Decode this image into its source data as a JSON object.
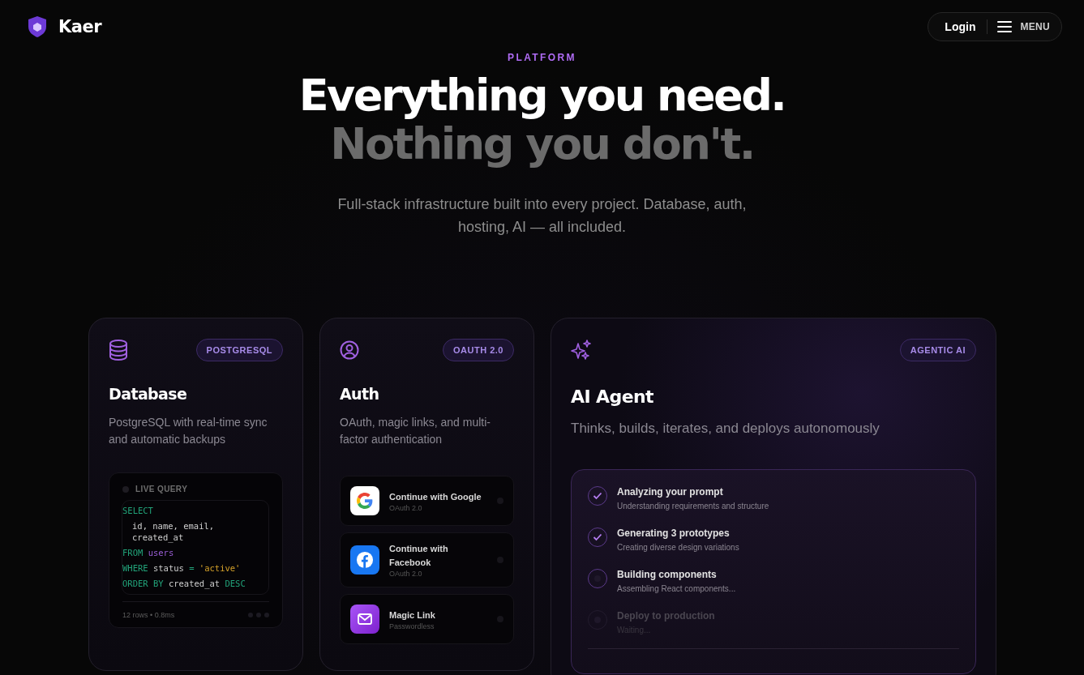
{
  "header": {
    "brand": "Kaer",
    "login": "Login",
    "menu": "MENU"
  },
  "hero": {
    "eyebrow": "PLATFORM",
    "title_line_1": "Everything you need.",
    "title_line_2": "Nothing you don't.",
    "subtitle": "Full-stack infrastructure built into every project. Database, auth, hosting, AI — all included."
  },
  "cards": [
    {
      "kind": "database",
      "badge": "POSTGRESQL",
      "title": "Database",
      "description": "PostgreSQL with real-time sync and automatic backups",
      "query": {
        "label": "LIVE QUERY",
        "lines": [
          [
            {
              "text": "SELECT",
              "kind": "keyword"
            }
          ],
          [
            {
              "text": "id, name, email, created_at",
              "kind": "plain"
            }
          ],
          [
            {
              "text": "FROM",
              "kind": "keyword"
            },
            {
              "text": "users",
              "kind": "table"
            }
          ],
          [
            {
              "text": "WHERE",
              "kind": "keyword"
            },
            {
              "text": "status",
              "kind": "plain"
            },
            {
              "text": "=",
              "kind": "keyword"
            },
            {
              "text": "'active'",
              "kind": "string"
            }
          ],
          [
            {
              "text": "ORDER BY",
              "kind": "keyword"
            },
            {
              "text": "created_at",
              "kind": "plain"
            },
            {
              "text": "DESC",
              "kind": "keyword"
            }
          ]
        ],
        "footer": "12 rows • 0.8ms"
      }
    },
    {
      "kind": "auth",
      "badge": "OAUTH 2.0",
      "title": "Auth",
      "description": "OAuth, magic links, and multi-factor authentication",
      "providers": [
        {
          "kind": "google",
          "label": "Continue with Google",
          "sub": "OAuth 2.0"
        },
        {
          "kind": "facebook",
          "label": "Continue with Facebook",
          "sub": "OAuth 2.0"
        },
        {
          "kind": "email",
          "label": "Magic Link",
          "sub": "Passwordless"
        }
      ]
    },
    {
      "kind": "agent",
      "badge": "AGENTIC AI",
      "title": "AI Agent",
      "description": "Thinks, builds, iterates, and deploys autonomously",
      "steps": [
        {
          "kind": "done",
          "title": "Analyzing your prompt",
          "sub": "Understanding requirements and structure"
        },
        {
          "kind": "done",
          "title": "Generating 3 prototypes",
          "sub": "Creating diverse design variations"
        },
        {
          "kind": "active",
          "title": "Building components",
          "sub": "Assembling React components..."
        },
        {
          "kind": "pending",
          "title": "Deploy to production",
          "sub": "Waiting..."
        }
      ]
    }
  ]
}
